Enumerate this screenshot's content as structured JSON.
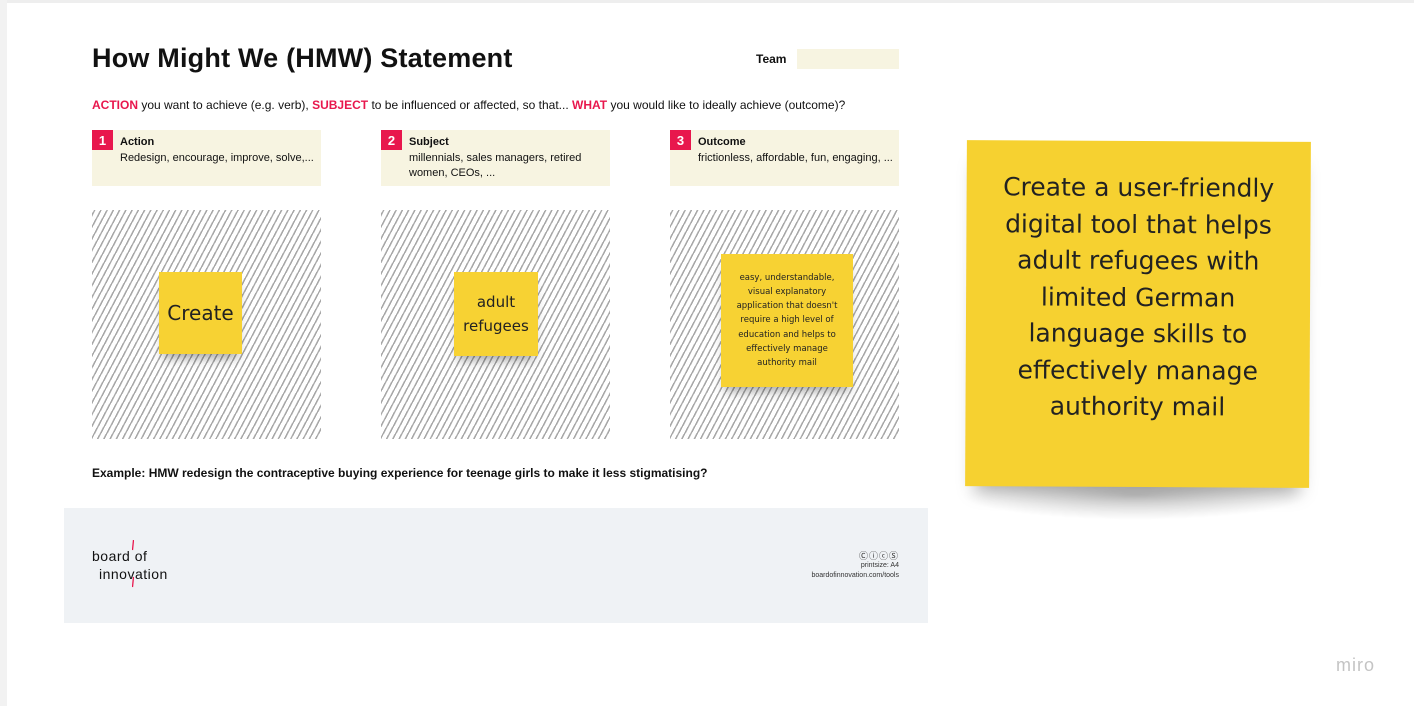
{
  "title": "How Might We (HMW) Statement",
  "team": {
    "label": "Team",
    "value": ""
  },
  "instruction": {
    "kw1": "ACTION",
    "t1": " you want to achieve (e.g. verb), ",
    "kw2": "SUBJECT",
    "t2": " to be influenced or affected, so that... ",
    "kw3": "WHAT",
    "t3": " you would like to ideally achieve (outcome)?"
  },
  "hints": [
    {
      "num": "1",
      "title": "Action",
      "body": "Redesign, encourage, improve, solve,..."
    },
    {
      "num": "2",
      "title": "Subject",
      "body": "millennials, sales managers, retired women, CEOs, ..."
    },
    {
      "num": "3",
      "title": "Outcome",
      "body": "frictionless, affordable, fun, engaging, ..."
    }
  ],
  "stickies": {
    "action": "Create",
    "subject": "adult refugees",
    "outcome": "easy, understandable, visual explanatory application that doesn't require a high level of education and helps to effectively manage authority mail"
  },
  "example": "Example: HMW redesign the contraceptive buying experience for teenage girls to make it less stigmatising?",
  "footer": {
    "logo_line1": "board of",
    "logo_line2": "innovation",
    "license_icons": "ⒸⓘⓒⓈ",
    "printsize": "printsize: A4",
    "site": "boardofinnovation.com/tools"
  },
  "statement": "Create a user-friendly digital tool that helps adult refugees with limited German language skills to effectively manage authority mail",
  "watermark": "miro",
  "colors": {
    "accent": "#e8174d",
    "sticky": "#f7d233",
    "hint_bg": "#f7f4e1",
    "footer_bg": "#eff2f5"
  }
}
